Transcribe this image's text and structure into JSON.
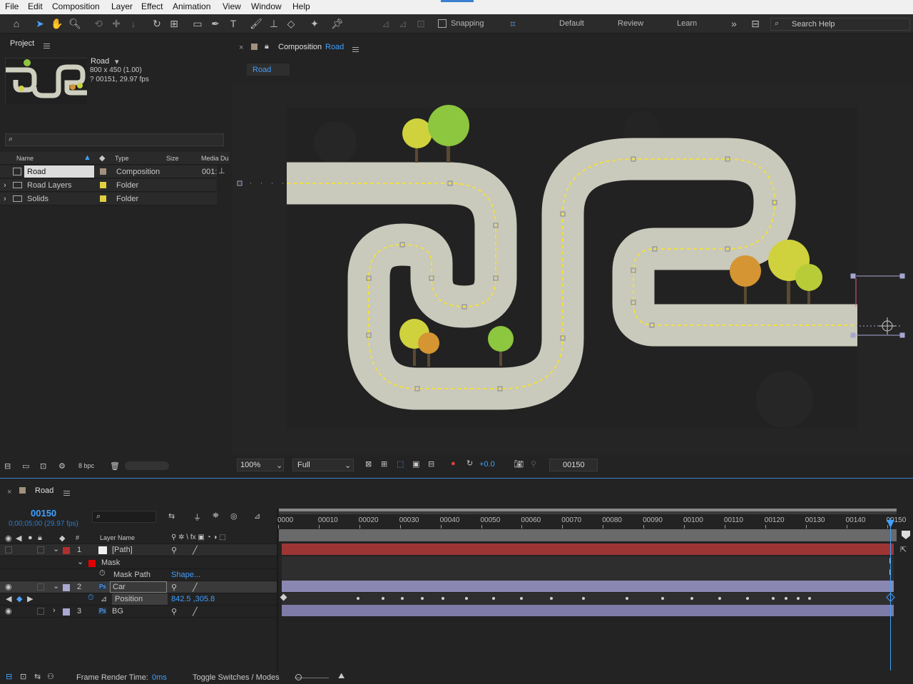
{
  "menu": [
    "File",
    "Edit",
    "Composition",
    "Layer",
    "Effect",
    "Animation",
    "View",
    "Window",
    "Help"
  ],
  "toolbar": {
    "snapping_label": "Snapping",
    "workspaces": [
      "Default",
      "Review",
      "Learn"
    ],
    "search_placeholder": "Search Help"
  },
  "project": {
    "title": "Project",
    "preview": {
      "name": "Road",
      "dimensions": "800 x 450 (1.00)",
      "duration": "? 00151, 29.97 fps"
    },
    "columns": [
      "Name",
      "Type",
      "Size",
      "Media Du"
    ],
    "items": [
      {
        "name": "Road",
        "type": "Composition",
        "duration": "001:",
        "color": "#a0907c"
      },
      {
        "name": "Road Layers",
        "type": "Folder",
        "duration": "",
        "color": "#e0d040"
      },
      {
        "name": "Solids",
        "type": "Folder",
        "duration": "",
        "color": "#e0d040"
      }
    ],
    "bpc_label": "8 bpc"
  },
  "composition": {
    "tab_prefix": "Composition",
    "tab_name": "Road",
    "breadcrumb": "Road",
    "zoom": "100%",
    "resolution": "Full",
    "exposure": "+0.0",
    "current_frame": "00150"
  },
  "timeline": {
    "comp_name": "Road",
    "current_time": "00150",
    "current_time_sub": "0;00;05;00 (29.97 fps)",
    "layer_name_header": "Layer Name",
    "hash_header": "#",
    "ruler": [
      "0000",
      "00010",
      "00020",
      "00030",
      "00040",
      "00050",
      "00060",
      "00070",
      "00080",
      "00090",
      "00100",
      "00110",
      "00120",
      "00130",
      "00140",
      "00150"
    ],
    "layers": [
      {
        "num": "1",
        "name": "[Path]",
        "color": "#b03030"
      },
      {
        "name": "Mask"
      },
      {
        "name": "Mask Path",
        "value": "Shape..."
      },
      {
        "num": "2",
        "name": "Car",
        "color": "#a8a8d0"
      },
      {
        "name": "Position",
        "value": "842.5 ,305.8"
      },
      {
        "num": "3",
        "name": "BG",
        "color": "#a8a8d0"
      }
    ],
    "footer": {
      "render_label": "Frame Render Time:",
      "render_value": "0ms",
      "toggle_label": "Toggle Switches / Modes"
    }
  },
  "colors": {
    "accent": "#3fa0ff",
    "path_bar": "#9e3535",
    "layer_bar": "#7e7ba8"
  }
}
